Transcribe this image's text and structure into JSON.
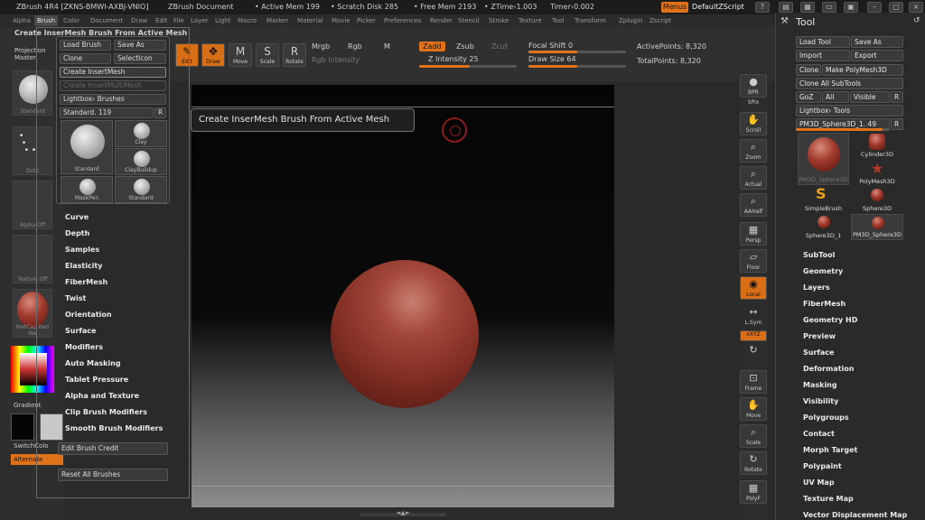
{
  "titlebar": {
    "app": "ZBrush 4R4 [ZKNS-BMWI-AXBJ-VNIO]",
    "document": "ZBrush Document",
    "active_mem": "• Active Mem 199",
    "scratch_disk": "• Scratch Disk 285",
    "free_mem": "• Free Mem 2193",
    "ztime": "• ZTime›1.003",
    "timer": "Timer›0.002",
    "menus_label": "Menus",
    "script_label": "DefaultZScript"
  },
  "menubar": {
    "items": [
      "Alpha",
      "Brush",
      "Color",
      "Document",
      "Draw",
      "Edit",
      "File",
      "Layer",
      "Light",
      "Macro",
      "Marker",
      "Material",
      "Movie",
      "Picker",
      "Preferences",
      "Render",
      "Stencil",
      "Stroke",
      "Texture",
      "Tool",
      "Transform",
      "Zplugin",
      "Zscript"
    ]
  },
  "toolbar": {
    "breadcrumb": "Create InserMesh Brush From Active Mesh",
    "projection_master": "Projection Master",
    "edit": "Edit",
    "draw": "Draw",
    "move": "Move",
    "scale": "Scale",
    "rotate": "Rotate",
    "mrgb": "Mrgb",
    "rgb": "Rgb",
    "m": "M",
    "rgb_intensity": "Rgb Intensity",
    "zadd": "Zadd",
    "zsub": "Zsub",
    "zcut": "Zcut",
    "z_intensity": "Z Intensity 25",
    "focal_shift": "Focal Shift 0",
    "draw_size": "Draw Size 64",
    "active_points": "ActivePoints: 8,320",
    "total_points": "TotalPoints: 8,320",
    "z_intensity_level": 0.25,
    "draw_size_level": 0.5
  },
  "leftshelf": {
    "standard": "Standard",
    "dots": "Dots",
    "alpha_off": "Alpha Off",
    "texture_off": "Texture Off",
    "matcap": "MatCap Red Wa",
    "gradient": "Gradient",
    "switch_color": "SwitchColo",
    "alternate": "Alternate"
  },
  "brush_panel": {
    "load_brush": "Load Brush",
    "save_as": "Save As",
    "clone": "Clone",
    "select_icon": "SelectIcon",
    "create_insertmesh": "Create InsertMesh",
    "create_insertmultimesh": "Create InsertMultiMesh",
    "lightbox_brushes": "Lightbox› Brushes",
    "current_brush": "Standard. 119",
    "r_label": "R",
    "thumbs": [
      "Standard",
      "Clay",
      "ClayBuildup",
      "MaskPen",
      "Standard"
    ]
  },
  "brush_menu": [
    "Curve",
    "Depth",
    "Samples",
    "Elasticity",
    "FiberMesh",
    "Twist",
    "Orientation",
    "Surface",
    "Modifiers",
    "Auto Masking",
    "Tablet Pressure",
    "Alpha and Texture",
    "Clip Brush Modifiers",
    "Smooth Brush Modifiers"
  ],
  "edit_brush_credit": "Edit Brush Credit",
  "reset_all_brushes": "Reset All Brushes",
  "tooltip": "Create InserMesh Brush From Active Mesh",
  "right_strip": [
    {
      "icon": "bpr-icon",
      "label": "BPR"
    },
    {
      "icon": "spix-icon",
      "label": "SPix"
    },
    {
      "icon": "scroll-icon",
      "label": "Scroll"
    },
    {
      "icon": "zoom-icon",
      "label": "Zoom"
    },
    {
      "icon": "actual-icon",
      "label": "Actual"
    },
    {
      "icon": "aahalf-icon",
      "label": "AAHalf"
    },
    {
      "icon": "persp-icon",
      "label": "Persp"
    },
    {
      "icon": "floor-icon",
      "label": "Floor"
    },
    {
      "icon": "local-icon",
      "label": "Local"
    },
    {
      "icon": "lsym-icon",
      "label": "L.Sym"
    },
    {
      "icon": "xyz-icon",
      "label": "xXYZ"
    },
    {
      "icon": "frame-icon",
      "label": "Frame"
    },
    {
      "icon": "move-icon",
      "label": "Move"
    },
    {
      "icon": "scale-icon",
      "label": "Scale"
    },
    {
      "icon": "rotate-icon",
      "label": "Rotate"
    },
    {
      "icon": "polyf-icon",
      "label": "PolyF"
    }
  ],
  "tool_palette": {
    "title": "Tool",
    "load_tool": "Load Tool",
    "save_as": "Save As",
    "import": "Import",
    "export": "Export",
    "clone": "Clone",
    "make_polymesh": "Make PolyMesh3D",
    "clone_all": "Clone All SubTools",
    "goz": "GoZ",
    "all": "All",
    "visible": "Visible",
    "r": "R",
    "lightbox_tools": "Lightbox› Tools",
    "current_tool": "PM3D_Sphere3D_1. 49",
    "thumbs": [
      "PM3D_Sphere3D",
      "Cylinder3D",
      "PolyMesh3D",
      "SimpleBrush",
      "Sphere3D",
      "Sphere3D_1",
      "PM3D_Sphere3D"
    ],
    "subpalettes": [
      "SubTool",
      "Geometry",
      "Layers",
      "FiberMesh",
      "Geometry HD",
      "Preview",
      "Surface",
      "Deformation",
      "Masking",
      "Visibility",
      "Polygroups",
      "Contact",
      "Morph Target",
      "Polypaint",
      "UV Map",
      "Texture Map",
      "Vector Displacement Map"
    ]
  }
}
